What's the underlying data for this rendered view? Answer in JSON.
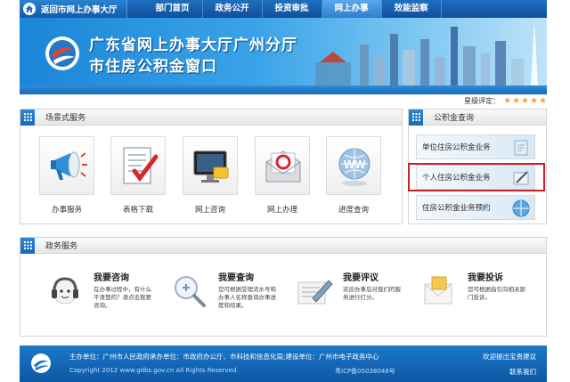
{
  "nav": {
    "home_label": "返回市网上办事大厅",
    "items": [
      {
        "label": "部门首页"
      },
      {
        "label": "政务公开"
      },
      {
        "label": "投资审批"
      },
      {
        "label": "网上办事"
      },
      {
        "label": "效能监察"
      }
    ],
    "active_index": 3
  },
  "banner": {
    "title_line1": "广东省网上办事大厅广州分厅",
    "title_line2": "市住房公积金窗口"
  },
  "scene_panel": {
    "title": "场景式服务",
    "items": [
      {
        "label": "办事服务",
        "icon": "megaphone-icon"
      },
      {
        "label": "表格下载",
        "icon": "form-check-icon"
      },
      {
        "label": "网上咨询",
        "icon": "monitor-icon"
      },
      {
        "label": "网上办理",
        "icon": "email-icon"
      },
      {
        "label": "进度查询",
        "icon": "globe-icon"
      }
    ]
  },
  "fund_panel": {
    "rating_label": "星级评定：",
    "rating_stars": 5,
    "title": "公积金查询",
    "items": [
      {
        "label": "单位住房公积金业务"
      },
      {
        "label": "个人住房公积金业务"
      },
      {
        "label": "住房公积金业务预约"
      }
    ],
    "highlight_color": "#c8202a"
  },
  "gov_panel": {
    "title": "政务服务",
    "items": [
      {
        "title": "我要咨询",
        "desc": "在办事过程中，有什么不清楚的？请点击我要咨询。",
        "icon": "headset-icon"
      },
      {
        "title": "我要查询",
        "desc": "您可根据受理流水号和办事人名称查询办事进度和结果。",
        "icon": "magnifier-icon"
      },
      {
        "title": "我要评议",
        "desc": "欢迎办事后对我们的服务进行打分。",
        "icon": "pen-paper-icon"
      },
      {
        "title": "我要投诉",
        "desc": "您可根据指引向相关部门投诉。",
        "icon": "envelope-icon"
      }
    ]
  },
  "footer": {
    "info": "主办单位：广州市人民政府承办单位：市政府办公厅、市科技和信息化局;建设单位：广州市电子政务中心",
    "copyright": "Copyright 2012 www.gdbs.gov.cn All Rights Reserved.",
    "icp": "粤ICP备05038048号",
    "link1": "欢迎提出宝贵建议",
    "link2": "联系我们"
  },
  "colors": {
    "nav_blue": "#1f6fc0",
    "banner_blue": "#1b86d8",
    "star": "#f2a33a",
    "highlight_red": "#c8202a"
  }
}
